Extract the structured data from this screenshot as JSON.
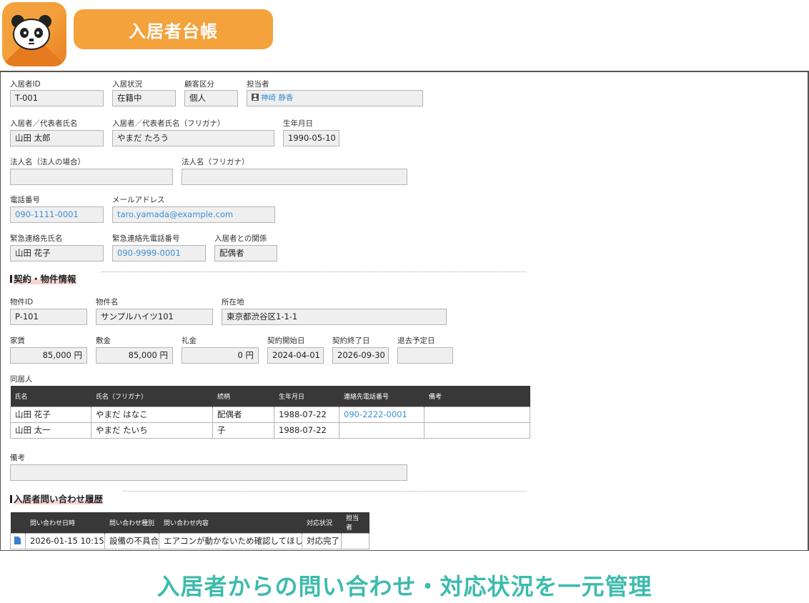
{
  "app": {
    "title": "入居者台帳",
    "icon": "panda-icon"
  },
  "tenant": {
    "id_label": "入居者ID",
    "id_value": "T-001",
    "status_label": "入居状況",
    "status_value": "在籍中",
    "customer_type_label": "顧客区分",
    "customer_type_value": "個人",
    "staff_label": "担当者",
    "staff_value": "神崎 静香",
    "name_label": "入居者／代表者氏名",
    "name_value": "山田 太郎",
    "kana_label": "入居者／代表者氏名（フリガナ）",
    "kana_value": "やまだ たろう",
    "birth_label": "生年月日",
    "birth_value": "1990-05-10",
    "corp_label": "法人名（法人の場合）",
    "corp_value": "",
    "corp_kana_label": "法人名（フリガナ）",
    "corp_kana_value": "",
    "phone_label": "電話番号",
    "phone_value": "090-1111-0001",
    "email_label": "メールアドレス",
    "email_value": "taro.yamada@example.com",
    "emergency_name_label": "緊急連絡先氏名",
    "emergency_name_value": "山田 花子",
    "emergency_phone_label": "緊急連絡先電話番号",
    "emergency_phone_value": "090-9999-0001",
    "relation_label": "入居者との関係",
    "relation_value": "配偶者"
  },
  "contract": {
    "section_title": "契約・物件情報",
    "property_id_label": "物件ID",
    "property_id_value": "P-101",
    "property_name_label": "物件名",
    "property_name_value": "サンプルハイツ101",
    "address_label": "所在地",
    "address_value": "東京都渋谷区1-1-1",
    "rent_label": "家賃",
    "rent_value": "85,000 円",
    "deposit_label": "敷金",
    "deposit_value": "85,000 円",
    "key_money_label": "礼金",
    "key_money_value": "0 円",
    "start_label": "契約開始日",
    "start_value": "2024-04-01",
    "end_label": "契約終了日",
    "end_value": "2026-09-30",
    "leave_label": "退去予定日",
    "leave_value": ""
  },
  "cohabitants": {
    "label": "同居人",
    "headers": [
      "氏名",
      "氏名（フリガナ）",
      "続柄",
      "生年月日",
      "連絡先電話番号",
      "備考"
    ],
    "rows": [
      [
        "山田 花子",
        "やまだ はなこ",
        "配偶者",
        "1988-07-22",
        "090-2222-0001",
        ""
      ],
      [
        "山田 太一",
        "やまだ たいち",
        "子",
        "1988-07-22",
        "",
        ""
      ]
    ]
  },
  "notes": {
    "label": "備考",
    "value": ""
  },
  "inquiries": {
    "section_title": "入居者問い合わせ履歴",
    "headers": [
      "",
      "問い合わせ日時",
      "問い合わせ種別",
      "問い合わせ内容",
      "対応状況",
      "担当者"
    ],
    "rows": [
      [
        "",
        "2026-01-15 10:15",
        "設備の不具合",
        "エアコンが動かないため確認してほしい",
        "対応完了",
        ""
      ]
    ]
  },
  "caption": "入居者からの問い合わせ・対応状況を一元管理",
  "colors": {
    "accent": "#f3a23c",
    "link": "#3a8fd6",
    "caption": "#3dbbad",
    "header": "#383838"
  }
}
